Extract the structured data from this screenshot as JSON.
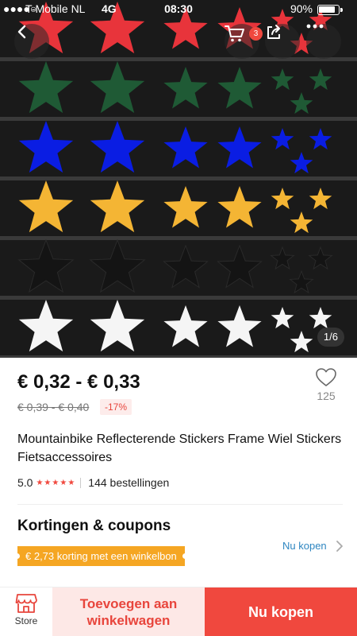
{
  "status_bar": {
    "carrier": "T-Mobile NL",
    "network": "4G",
    "time": "08:30",
    "battery": "90%"
  },
  "gallery": {
    "counter": "1/6",
    "star_colors": [
      "#e8343b",
      "#1f5a35",
      "#0a1de3",
      "#f4b534",
      "#141414",
      "#f5f5f5"
    ],
    "cart_badge": "3"
  },
  "product": {
    "price": "€ 0,32 - € 0,33",
    "old_price": "€ 0,39 - € 0,40",
    "discount": "-17%",
    "wishlist_count": "125",
    "title": "Mountainbike Reflecterende Stickers Frame Wiel Stickers Fietsaccessoires",
    "rating": "5.0",
    "stars": "★★★★★",
    "orders": "144 bestellingen"
  },
  "coupons": {
    "title": "Kortingen & coupons",
    "coupon_label": "€ 2,73 korting met een winkelbon",
    "link": "Nu kopen"
  },
  "bottom_bar": {
    "store_label": "Store",
    "add_to_cart": "Toevoegen aan winkelwagen",
    "buy_now": "Nu kopen"
  },
  "colors": {
    "accent": "#f0483e",
    "coupon": "#f5a623",
    "link": "#2e86c1"
  }
}
